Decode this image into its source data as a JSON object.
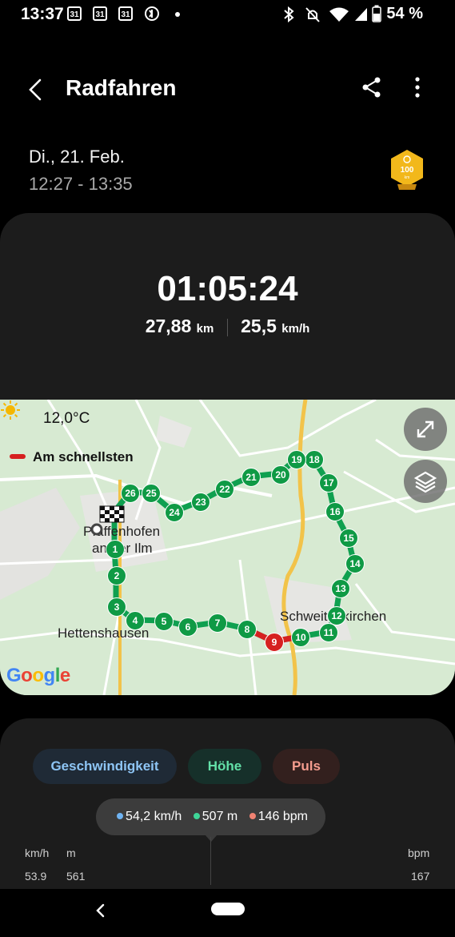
{
  "status_bar": {
    "time": "13:37",
    "calendar_day": "31",
    "battery": "54 %"
  },
  "app_bar": {
    "title": "Radfahren",
    "back_icon": "back-arrow-icon",
    "share_icon": "share-icon",
    "more_icon": "more-vert-icon"
  },
  "workout": {
    "date": "Di., 21. Feb.",
    "time_range": "12:27 - 13:35",
    "medal": "100",
    "medal_unit": "km",
    "duration": "01:05:24",
    "distance": "27,88",
    "distance_unit": "km",
    "speed": "25,5",
    "speed_unit": "km/h"
  },
  "map": {
    "temperature": "12,0°C",
    "legend_fastest": "Am schnellsten",
    "places": [
      "Pfaffenhofen",
      "an der Ilm",
      "Hettenshausen",
      "Schweitenkirchen"
    ],
    "expand_icon": "expand-icon",
    "layers_icon": "layers-icon",
    "attribution": "Google",
    "waypoints": [
      "1",
      "2",
      "3",
      "4",
      "5",
      "6",
      "7",
      "8",
      "9",
      "10",
      "11",
      "12",
      "13",
      "14",
      "15",
      "16",
      "17",
      "18",
      "19",
      "20",
      "21",
      "22",
      "23",
      "24",
      "25",
      "26"
    ],
    "fastest_segment": "9"
  },
  "chart": {
    "tabs": [
      "Geschwindigkeit",
      "Höhe",
      "Puls"
    ],
    "tooltip": {
      "speed": "54,2 km/h",
      "elevation": "507 m",
      "heart_rate": "146 bpm"
    },
    "left_units": [
      "km/h",
      "m"
    ],
    "left_values": [
      "53.9",
      "561"
    ],
    "right_unit": "bpm",
    "right_value": "167",
    "colors": {
      "speed": "#6fb3f2",
      "elevation": "#3ed597",
      "heart_rate": "#f08272"
    }
  }
}
